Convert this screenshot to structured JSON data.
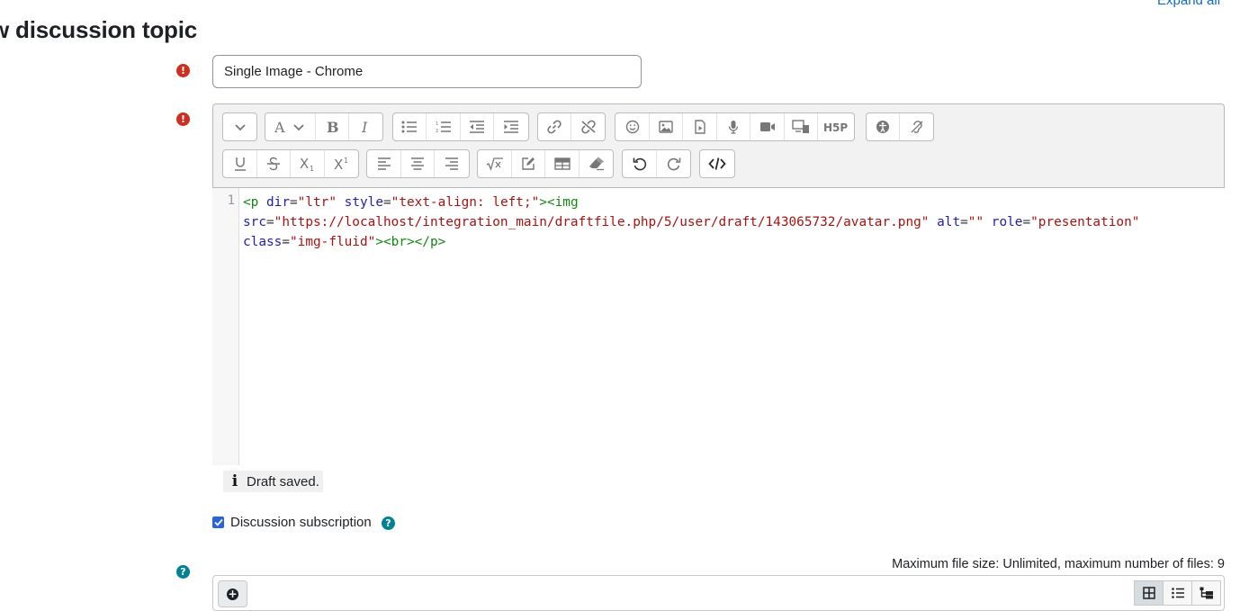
{
  "header": {
    "page_title": "w discussion topic",
    "expand_all": "Expand all"
  },
  "subject": {
    "value": "Single Image - Chrome"
  },
  "editor": {
    "toolbar_row1": [
      [
        "paragraph-styles"
      ],
      [
        "font-color",
        "bold",
        "italic"
      ],
      [
        "unordered-list",
        "ordered-list",
        "outdent",
        "indent"
      ],
      [
        "link",
        "unlink"
      ],
      [
        "emoji",
        "image",
        "media",
        "record-audio",
        "record-video",
        "manage-files",
        "h5p"
      ],
      [
        "accessibility-checker",
        "screenreader-helper"
      ]
    ],
    "toolbar_row2": [
      [
        "underline",
        "strikethrough",
        "subscript",
        "superscript"
      ],
      [
        "align-left",
        "align-center",
        "align-right"
      ],
      [
        "equation",
        "special-character",
        "table",
        "clear-formatting"
      ],
      [
        "undo",
        "redo"
      ],
      [
        "html"
      ]
    ],
    "line_number": "1",
    "code": {
      "tag_open_p": "<p",
      "attr_dir": "dir",
      "val_dir": "\"ltr\"",
      "attr_style": "style",
      "val_style": "\"text-align: left;\"",
      "tag_close_open_img": "><img",
      "attr_src": "src",
      "val_src": "\"https://localhost/integration_main/draftfile.php/5/user/draft/143065732/avatar.png\"",
      "attr_alt": "alt",
      "val_alt": "\"\"",
      "attr_role": "role",
      "val_role": "\"presentation\"",
      "attr_class": "class",
      "val_class": "\"img-fluid\"",
      "tag_end": "><br></p>"
    }
  },
  "draft_status": {
    "icon": "i",
    "text": "Draft saved."
  },
  "subscription": {
    "label": "Discussion subscription",
    "checked": true
  },
  "attachments": {
    "max_size_text": "Maximum file size: Unlimited, maximum number of files: 9"
  },
  "colors": {
    "required": "#ca3120",
    "help": "#008196",
    "link": "#0f6cbf",
    "checkbox": "#2865d6"
  }
}
